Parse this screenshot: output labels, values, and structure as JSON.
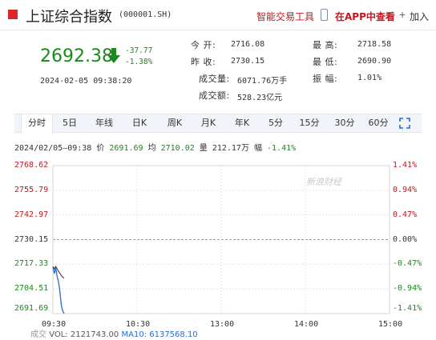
{
  "header": {
    "title": "上证综合指数",
    "code": "(000001.SH)",
    "tool_link": "智能交易工具",
    "app_link": "在APP中查看",
    "add_label": "加入",
    "brand_color": "#c4161c"
  },
  "quote": {
    "price": "2692.38",
    "change": "-37.77",
    "change_pct": "-1.38%",
    "datetime": "2024-02-05  09:38:20",
    "trend_color": "#1a8a1a",
    "stats": [
      {
        "label": "今    开:",
        "value": "2716.08"
      },
      {
        "label": "最    高:",
        "value": "2718.58"
      },
      {
        "label": "昨    收:",
        "value": "2730.15"
      },
      {
        "label": "最    低:",
        "value": "2690.90"
      },
      {
        "label": "成交量:",
        "value": "6071.76万手"
      },
      {
        "label": "振    幅:",
        "value": "1.01%"
      },
      {
        "label": "成交额:",
        "value": "528.23亿元"
      }
    ]
  },
  "tabs": [
    "分时",
    "5日",
    "年线",
    "日K",
    "周K",
    "月K",
    "年K",
    "5分",
    "15分",
    "30分",
    "60分"
  ],
  "active_tab": "分时",
  "info_line": {
    "time": "2024/02/05—09:38",
    "price_label": "价",
    "price": "2691.69",
    "avg_label": "均",
    "avg": "2710.02",
    "vol_label": "量",
    "vol": "212.17万",
    "amp_label": "幅",
    "amp": "-1.41%"
  },
  "watermark": "新浪财经",
  "chart_data": {
    "type": "line",
    "x_ticks": [
      "09:30",
      "10:30",
      "13:00",
      "14:00",
      "15:00"
    ],
    "y_ticks": [
      "2768.62",
      "2755.79",
      "2742.97",
      "2730.15",
      "2717.33",
      "2704.51",
      "2691.69"
    ],
    "y_pct_ticks": [
      "1.41%",
      "0.94%",
      "0.47%",
      "0.00%",
      "-0.47%",
      "-0.94%",
      "-1.41%"
    ],
    "ylim": [
      2691.69,
      2768.62
    ],
    "reference": 2730.15,
    "series": [
      {
        "values": [
          {
            "t": "09:30",
            "v": 2716.08
          },
          {
            "t": "09:31",
            "v": 2712.5
          },
          {
            "t": "09:32",
            "v": 2715.6
          },
          {
            "t": "09:33",
            "v": 2711.0
          },
          {
            "t": "09:34",
            "v": 2708.2
          },
          {
            "t": "09:35",
            "v": 2703.0
          },
          {
            "t": "09:36",
            "v": 2696.0
          },
          {
            "t": "09:37",
            "v": 2693.0
          },
          {
            "t": "09:38",
            "v": 2691.69
          }
        ]
      }
    ],
    "avg_series": [
      {
        "t": "09:30",
        "v": 2716.08
      },
      {
        "t": "09:31",
        "v": 2715.0
      },
      {
        "t": "09:32",
        "v": 2716.2
      },
      {
        "t": "09:33",
        "v": 2715.0
      },
      {
        "t": "09:34",
        "v": 2713.6
      },
      {
        "t": "09:35",
        "v": 2712.6
      },
      {
        "t": "09:36",
        "v": 2711.4
      },
      {
        "t": "09:37",
        "v": 2710.6
      },
      {
        "t": "09:38",
        "v": 2710.02
      }
    ],
    "grid": true,
    "up_color": "#c4161c",
    "down_color": "#1a8a1a"
  },
  "footer": {
    "vol_label": "成交",
    "vol": "VOL: 2121743.00",
    "ma10": "MA10: 6137568.10"
  }
}
